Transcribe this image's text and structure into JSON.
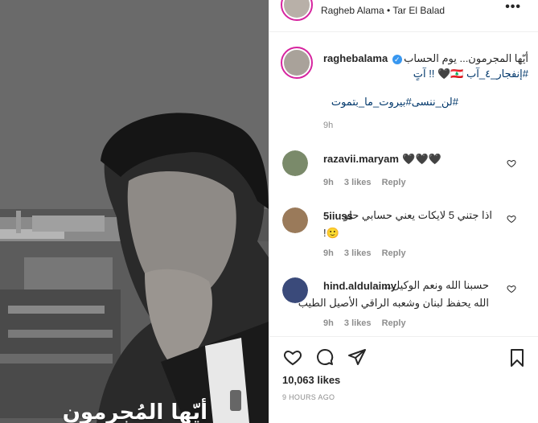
{
  "post": {
    "overlay_text": "أيّها المُجرمون",
    "header_username": "raghebalama",
    "header_location": "Ragheb Alama • Tar El Balad",
    "more_label": "•••"
  },
  "caption": {
    "username": "raghebalama",
    "verified_mark": "✓",
    "line1": "أيّها المجرمون... يوم الحساب",
    "line2": "#إنفجار_٤_آب 🇱🇧🖤 !! آتٍ",
    "line3": "#لن_ننسى#بيروت_ما_بتموت",
    "time": "9h"
  },
  "comments": [
    {
      "user": "razavii.maryam",
      "text": "🖤🖤🖤",
      "time": "9h",
      "likes": "3 likes",
      "reply": "Reply",
      "avatar_color": "#7a8a6a"
    },
    {
      "user": "5iiuss",
      "text": "اذا جتني 5 لايكات يعني حسابي حلو",
      "text2": "!🙂",
      "time": "9h",
      "likes": "3 likes",
      "reply": "Reply",
      "avatar_color": "#9a7a5a"
    },
    {
      "user": "hind.aldulaimy",
      "text": "حسبنا الله ونعم الوكيل...",
      "text2": "الله يحفظ لبنان وشعبه الراقي الأصيل الطيب",
      "time": "9h",
      "likes": "3 likes",
      "reply": "Reply",
      "avatar_color": "#3a4a7a"
    }
  ],
  "actions": {
    "like_icon": "heart-icon",
    "comment_icon": "comment-bubble-icon",
    "share_icon": "paper-plane-icon",
    "save_icon": "bookmark-icon"
  },
  "likes_count": "10,063 likes",
  "posted_time": "9 HOURS AGO",
  "colors": {
    "link": "#00376b",
    "muted": "#8e8e8e",
    "verified": "#3897f0",
    "ring": "#d6249f"
  }
}
